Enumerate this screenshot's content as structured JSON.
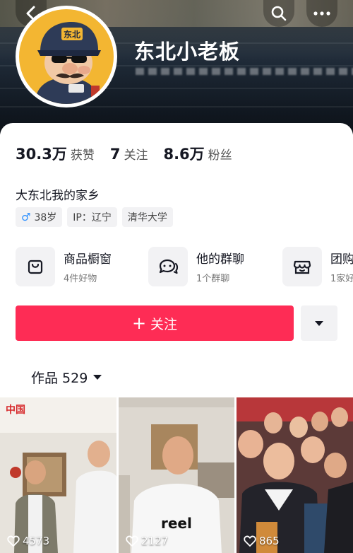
{
  "header": {
    "nickname": "东北小老板",
    "avatar_badge_text": "东北"
  },
  "icons": {
    "back": "chevron-left-icon",
    "search": "search-icon",
    "more": "more-dots-icon"
  },
  "stats": [
    {
      "value": "30.3万",
      "label": "获赞"
    },
    {
      "value": "7",
      "label": "关注"
    },
    {
      "value": "8.6万",
      "label": "粉丝"
    }
  ],
  "bio": "大东北我的家乡",
  "tags": {
    "gender_symbol": "♂",
    "age": "38岁",
    "ip": "IP：辽宁",
    "school": "清华大学"
  },
  "services": [
    {
      "title": "商品橱窗",
      "subtitle": "4件好物"
    },
    {
      "title": "他的群聊",
      "subtitle": "1个群聊"
    },
    {
      "title": "团购",
      "subtitle": "1家好"
    }
  ],
  "follow_label": "关注",
  "works_tab_label": "作品 529",
  "videos": [
    {
      "likes": "4573"
    },
    {
      "likes": "2127"
    },
    {
      "likes": "865"
    }
  ],
  "colors": {
    "accent": "#fe2c55",
    "gender_male": "#2b8fff"
  }
}
